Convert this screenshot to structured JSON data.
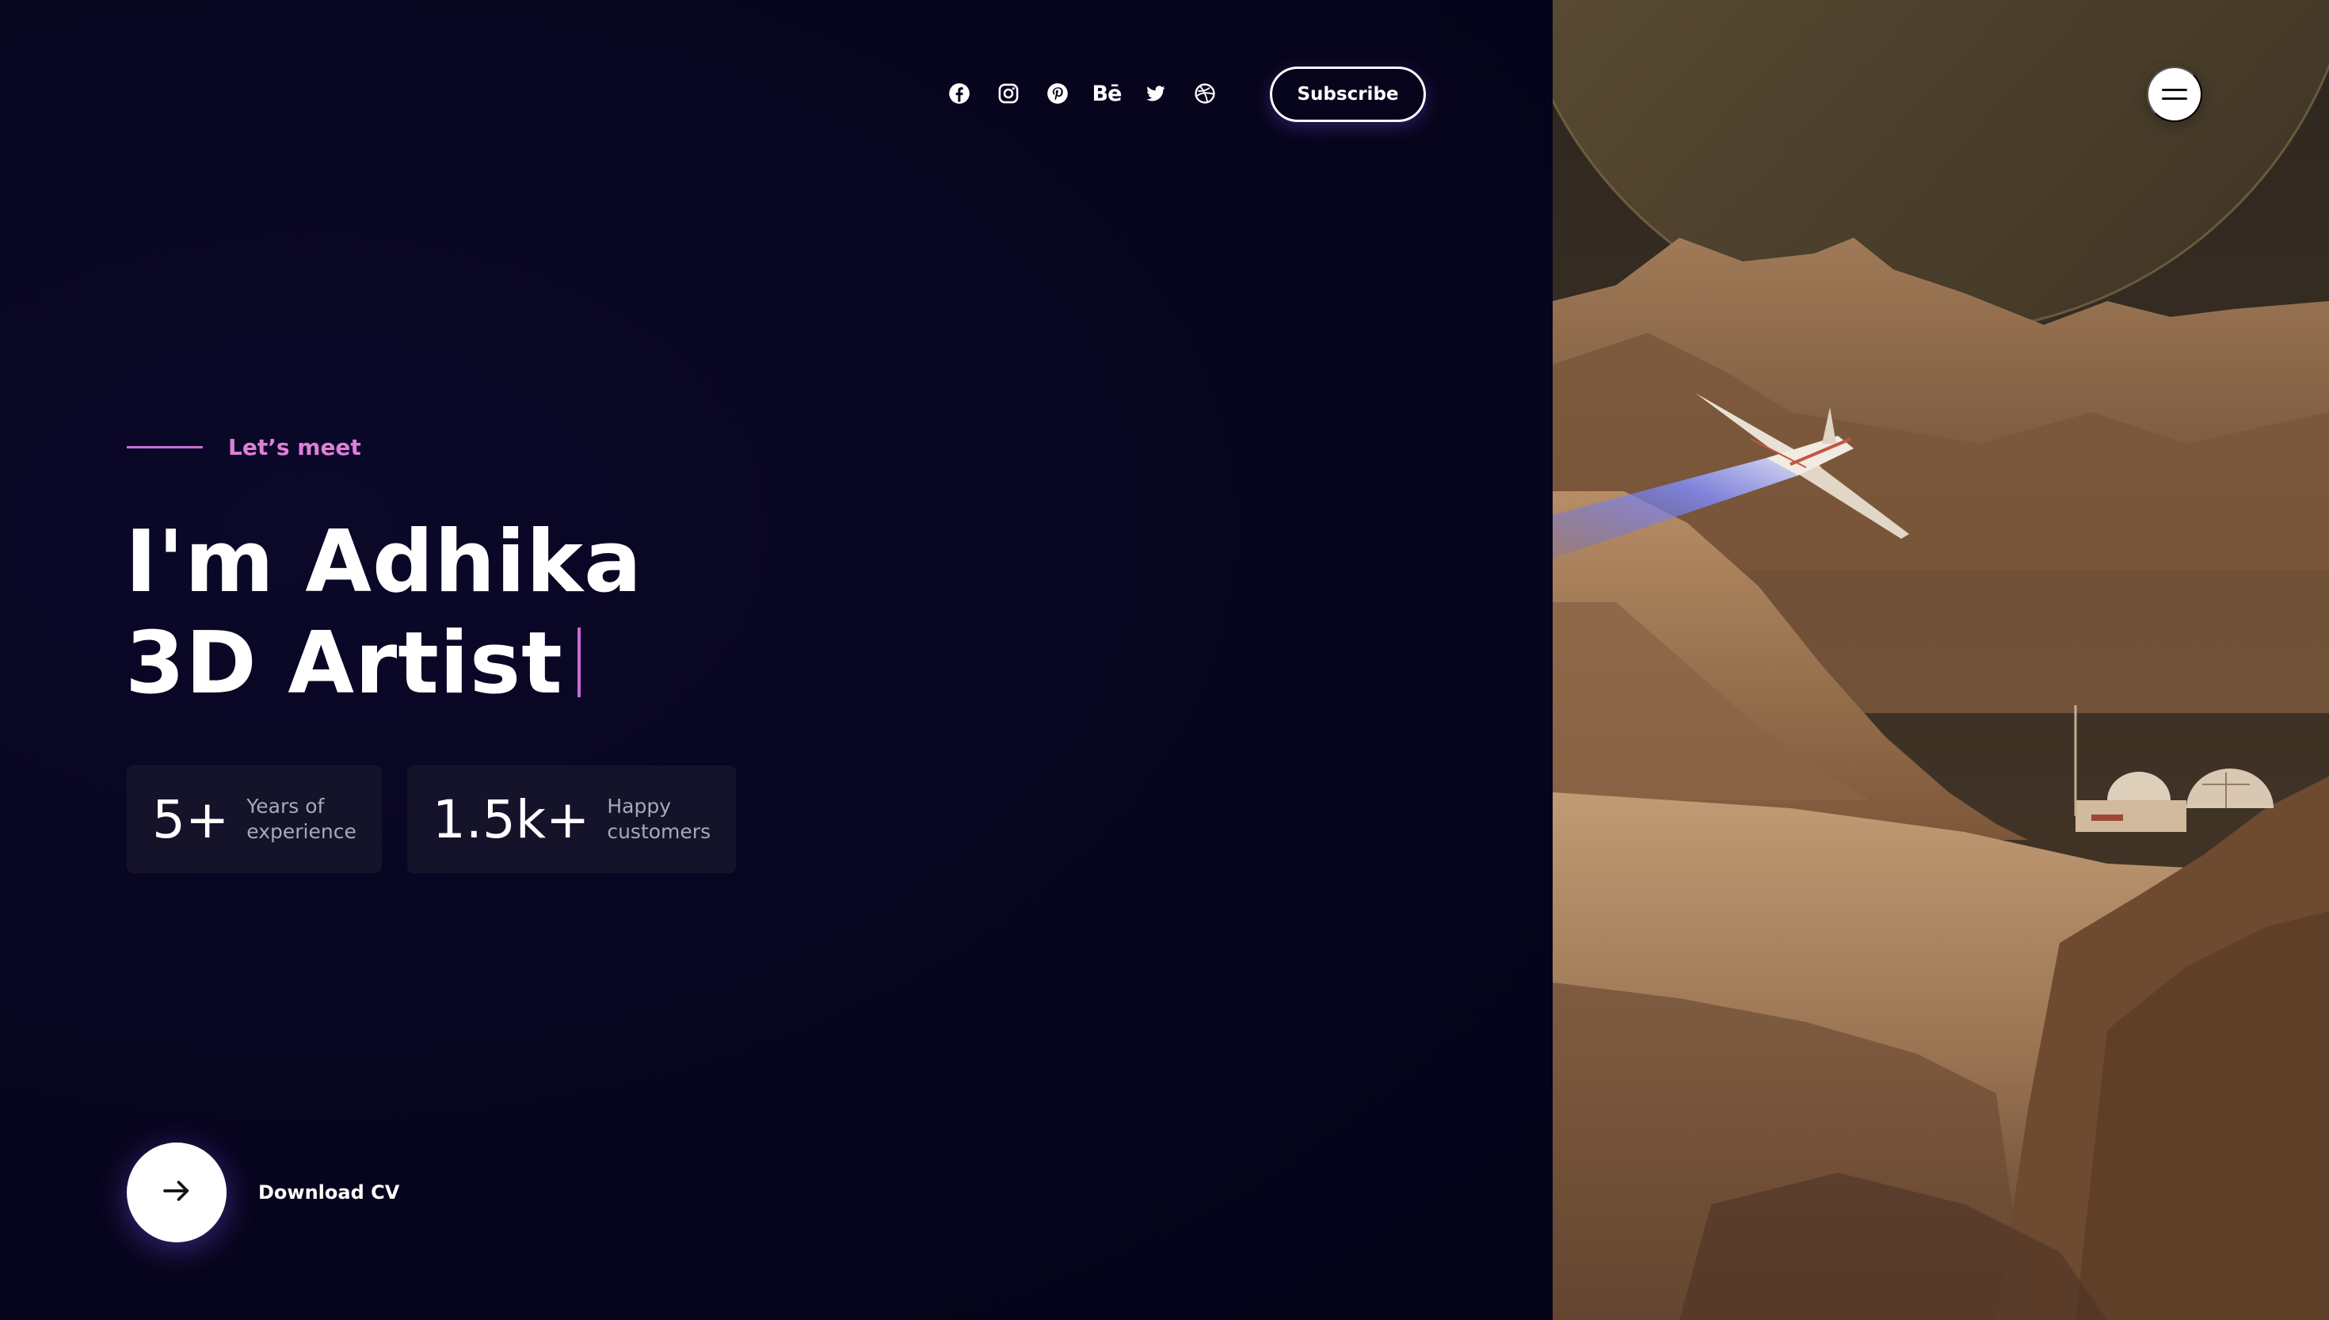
{
  "header": {
    "social": [
      {
        "name": "facebook-icon"
      },
      {
        "name": "instagram-icon"
      },
      {
        "name": "pinterest-icon"
      },
      {
        "name": "behance-icon",
        "glyph": "Bē"
      },
      {
        "name": "twitter-icon"
      },
      {
        "name": "dribbble-icon"
      }
    ],
    "subscribe_label": "Subscribe"
  },
  "hero": {
    "eyebrow": "Let’s meet",
    "title_line1": "I'm Adhika",
    "title_line2": "3D Artist"
  },
  "stats": [
    {
      "value": "5+",
      "label_line1": "Years of",
      "label_line2": "experience"
    },
    {
      "value": "1.5k+",
      "label_line1": "Happy",
      "label_line2": "customers"
    }
  ],
  "cta": {
    "download_label": "Download CV",
    "icon": "arrow-right-icon"
  },
  "menu": {
    "icon": "hamburger-menu-icon"
  },
  "colors": {
    "background": "#07051d",
    "accent": "#e07fd8",
    "card": "#14132a",
    "text": "#ffffff",
    "muted": "#a8a8b8"
  }
}
